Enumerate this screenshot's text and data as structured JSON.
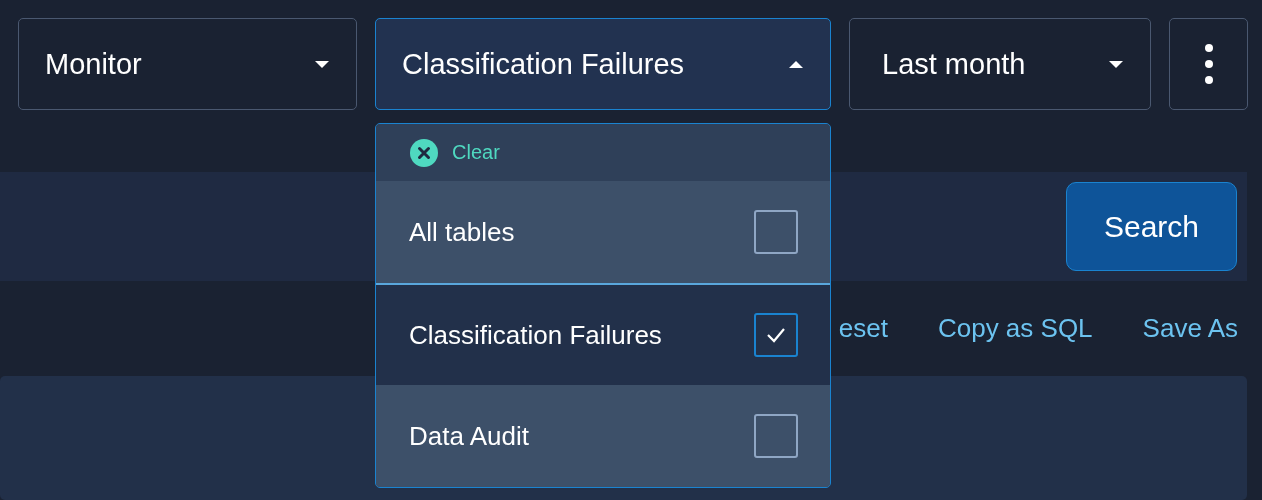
{
  "filters": [
    {
      "value": "Monitor",
      "expanded": false
    },
    {
      "value": "Classification Failures",
      "expanded": true
    },
    {
      "value": "Last month",
      "expanded": false
    }
  ],
  "menu": {
    "clear": "Clear",
    "options": [
      {
        "label": "All tables",
        "checked": false
      },
      {
        "label": "Classification Failures",
        "checked": true
      },
      {
        "label": "Data Audit",
        "checked": false
      }
    ]
  },
  "search_button": "Search",
  "links": [
    "eset",
    "Copy as SQL",
    "Save As"
  ]
}
